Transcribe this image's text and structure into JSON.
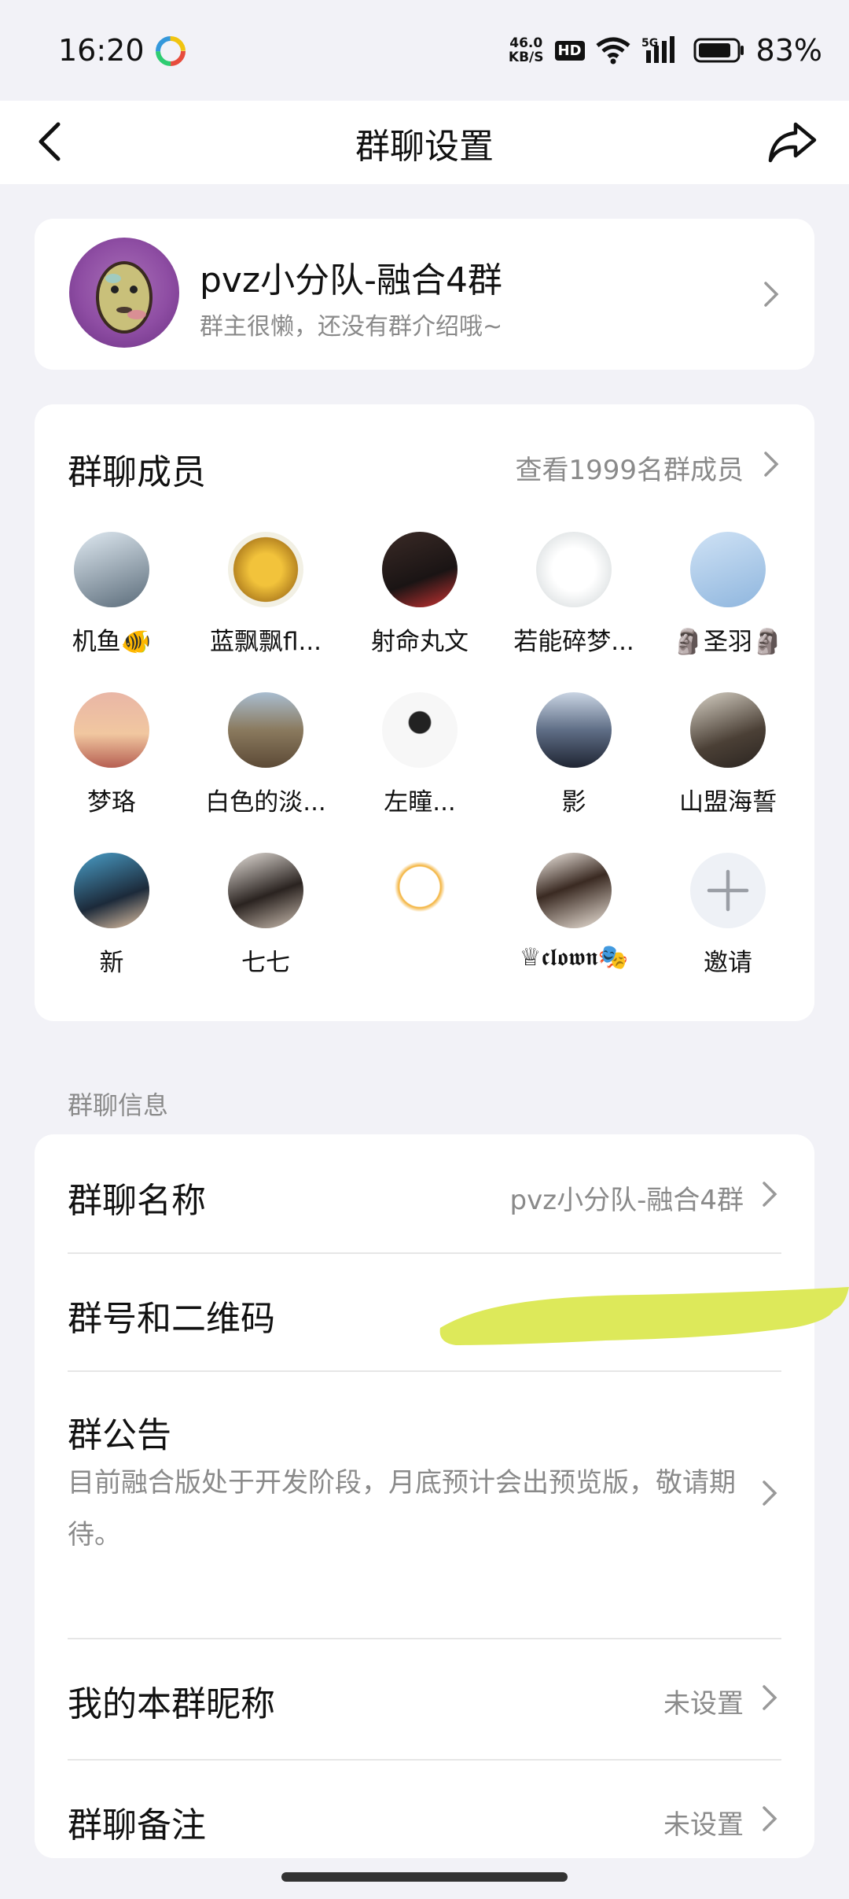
{
  "status": {
    "time": "16:20",
    "speed_top": "46.0",
    "speed_unit": "KB/S",
    "hd": "HD",
    "battery": "83%"
  },
  "nav": {
    "title": "群聊设置"
  },
  "group": {
    "name": "pvz小分队-融合4群",
    "intro": "群主很懒，还没有群介绍哦~"
  },
  "members": {
    "title": "群聊成员",
    "view_all": "查看1999名群成员",
    "list": [
      {
        "name": "机鱼🐠"
      },
      {
        "name": "蓝飘飘fl..."
      },
      {
        "name": "射命丸文"
      },
      {
        "name": "若能碎梦..."
      },
      {
        "name": "🗿圣羽🗿"
      },
      {
        "name": "梦珞"
      },
      {
        "name": "白色的淡..."
      },
      {
        "name": "左瞳..."
      },
      {
        "name": "影"
      },
      {
        "name": "山盟海誓"
      },
      {
        "name": "新"
      },
      {
        "name": "七七"
      },
      {
        "name": ""
      },
      {
        "name": "♕𝖈𝖑𝖔𝖜𝖓🎭"
      },
      {
        "name": "邀请"
      }
    ]
  },
  "info": {
    "section_label": "群聊信息",
    "group_name_label": "群聊名称",
    "group_name_value": "pvz小分队-融合4群",
    "qr_label": "群号和二维码",
    "notice_label": "群公告",
    "notice_text": "目前融合版处于开发阶段，月底预计会出预览版，敬请期待。",
    "nickname_label": "我的本群昵称",
    "nickname_value": "未设置",
    "remark_label": "群聊备注",
    "remark_value": "未设置"
  },
  "colors": {
    "background": "#f2f2f7",
    "card": "#ffffff",
    "secondary_text": "#8a8a8a",
    "highlight": "#dde95a"
  }
}
